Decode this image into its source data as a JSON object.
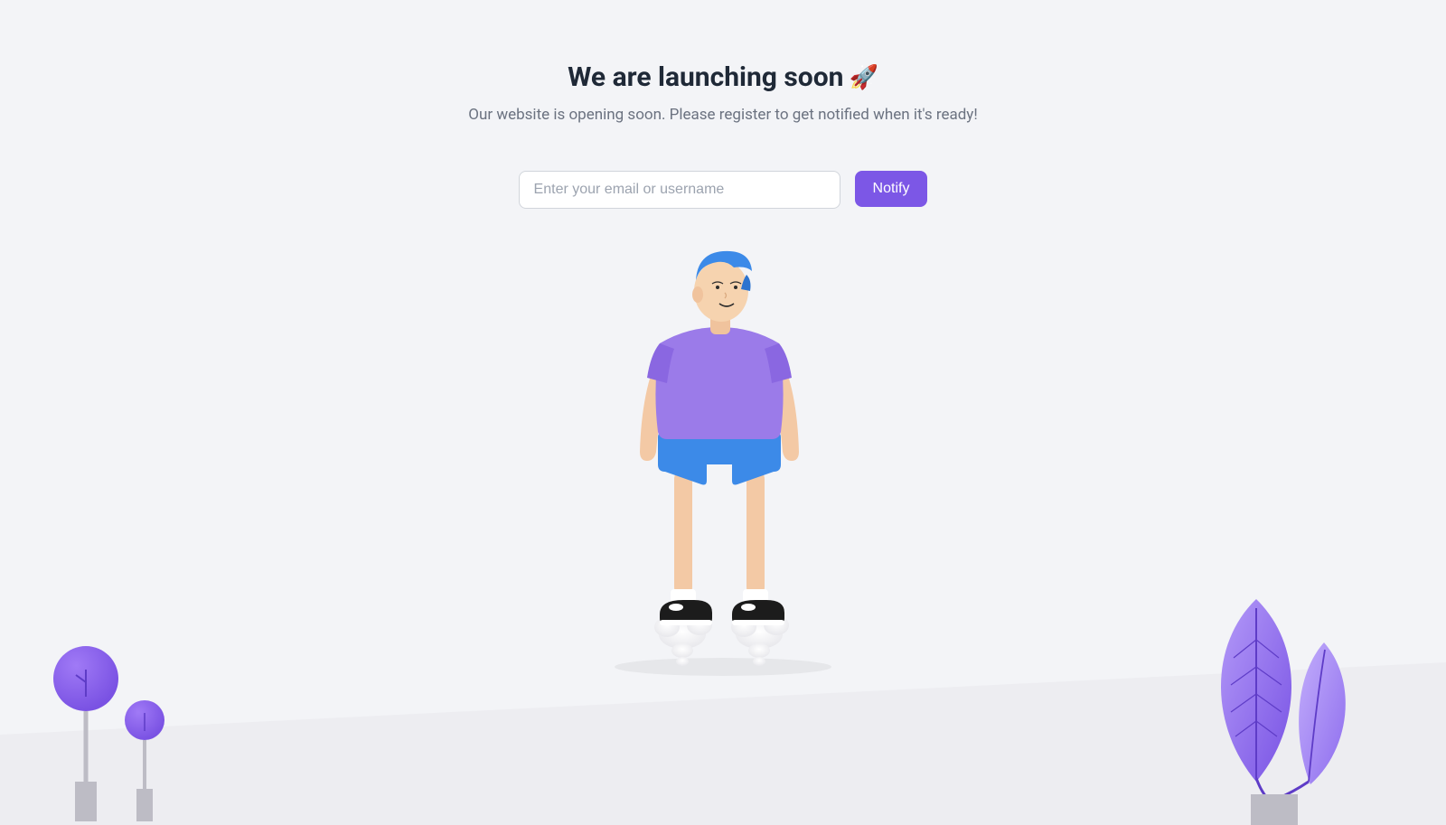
{
  "heading": "We are launching soon",
  "rocket_emoji": "🚀",
  "subheading": "Our website is opening soon. Please register to get notified when it's ready!",
  "email_placeholder": "Enter your email or username",
  "notify_label": "Notify",
  "colors": {
    "background": "#f3f4f7",
    "accent": "#7c57e6",
    "text": "#1f2937",
    "muted": "#6b7280"
  }
}
